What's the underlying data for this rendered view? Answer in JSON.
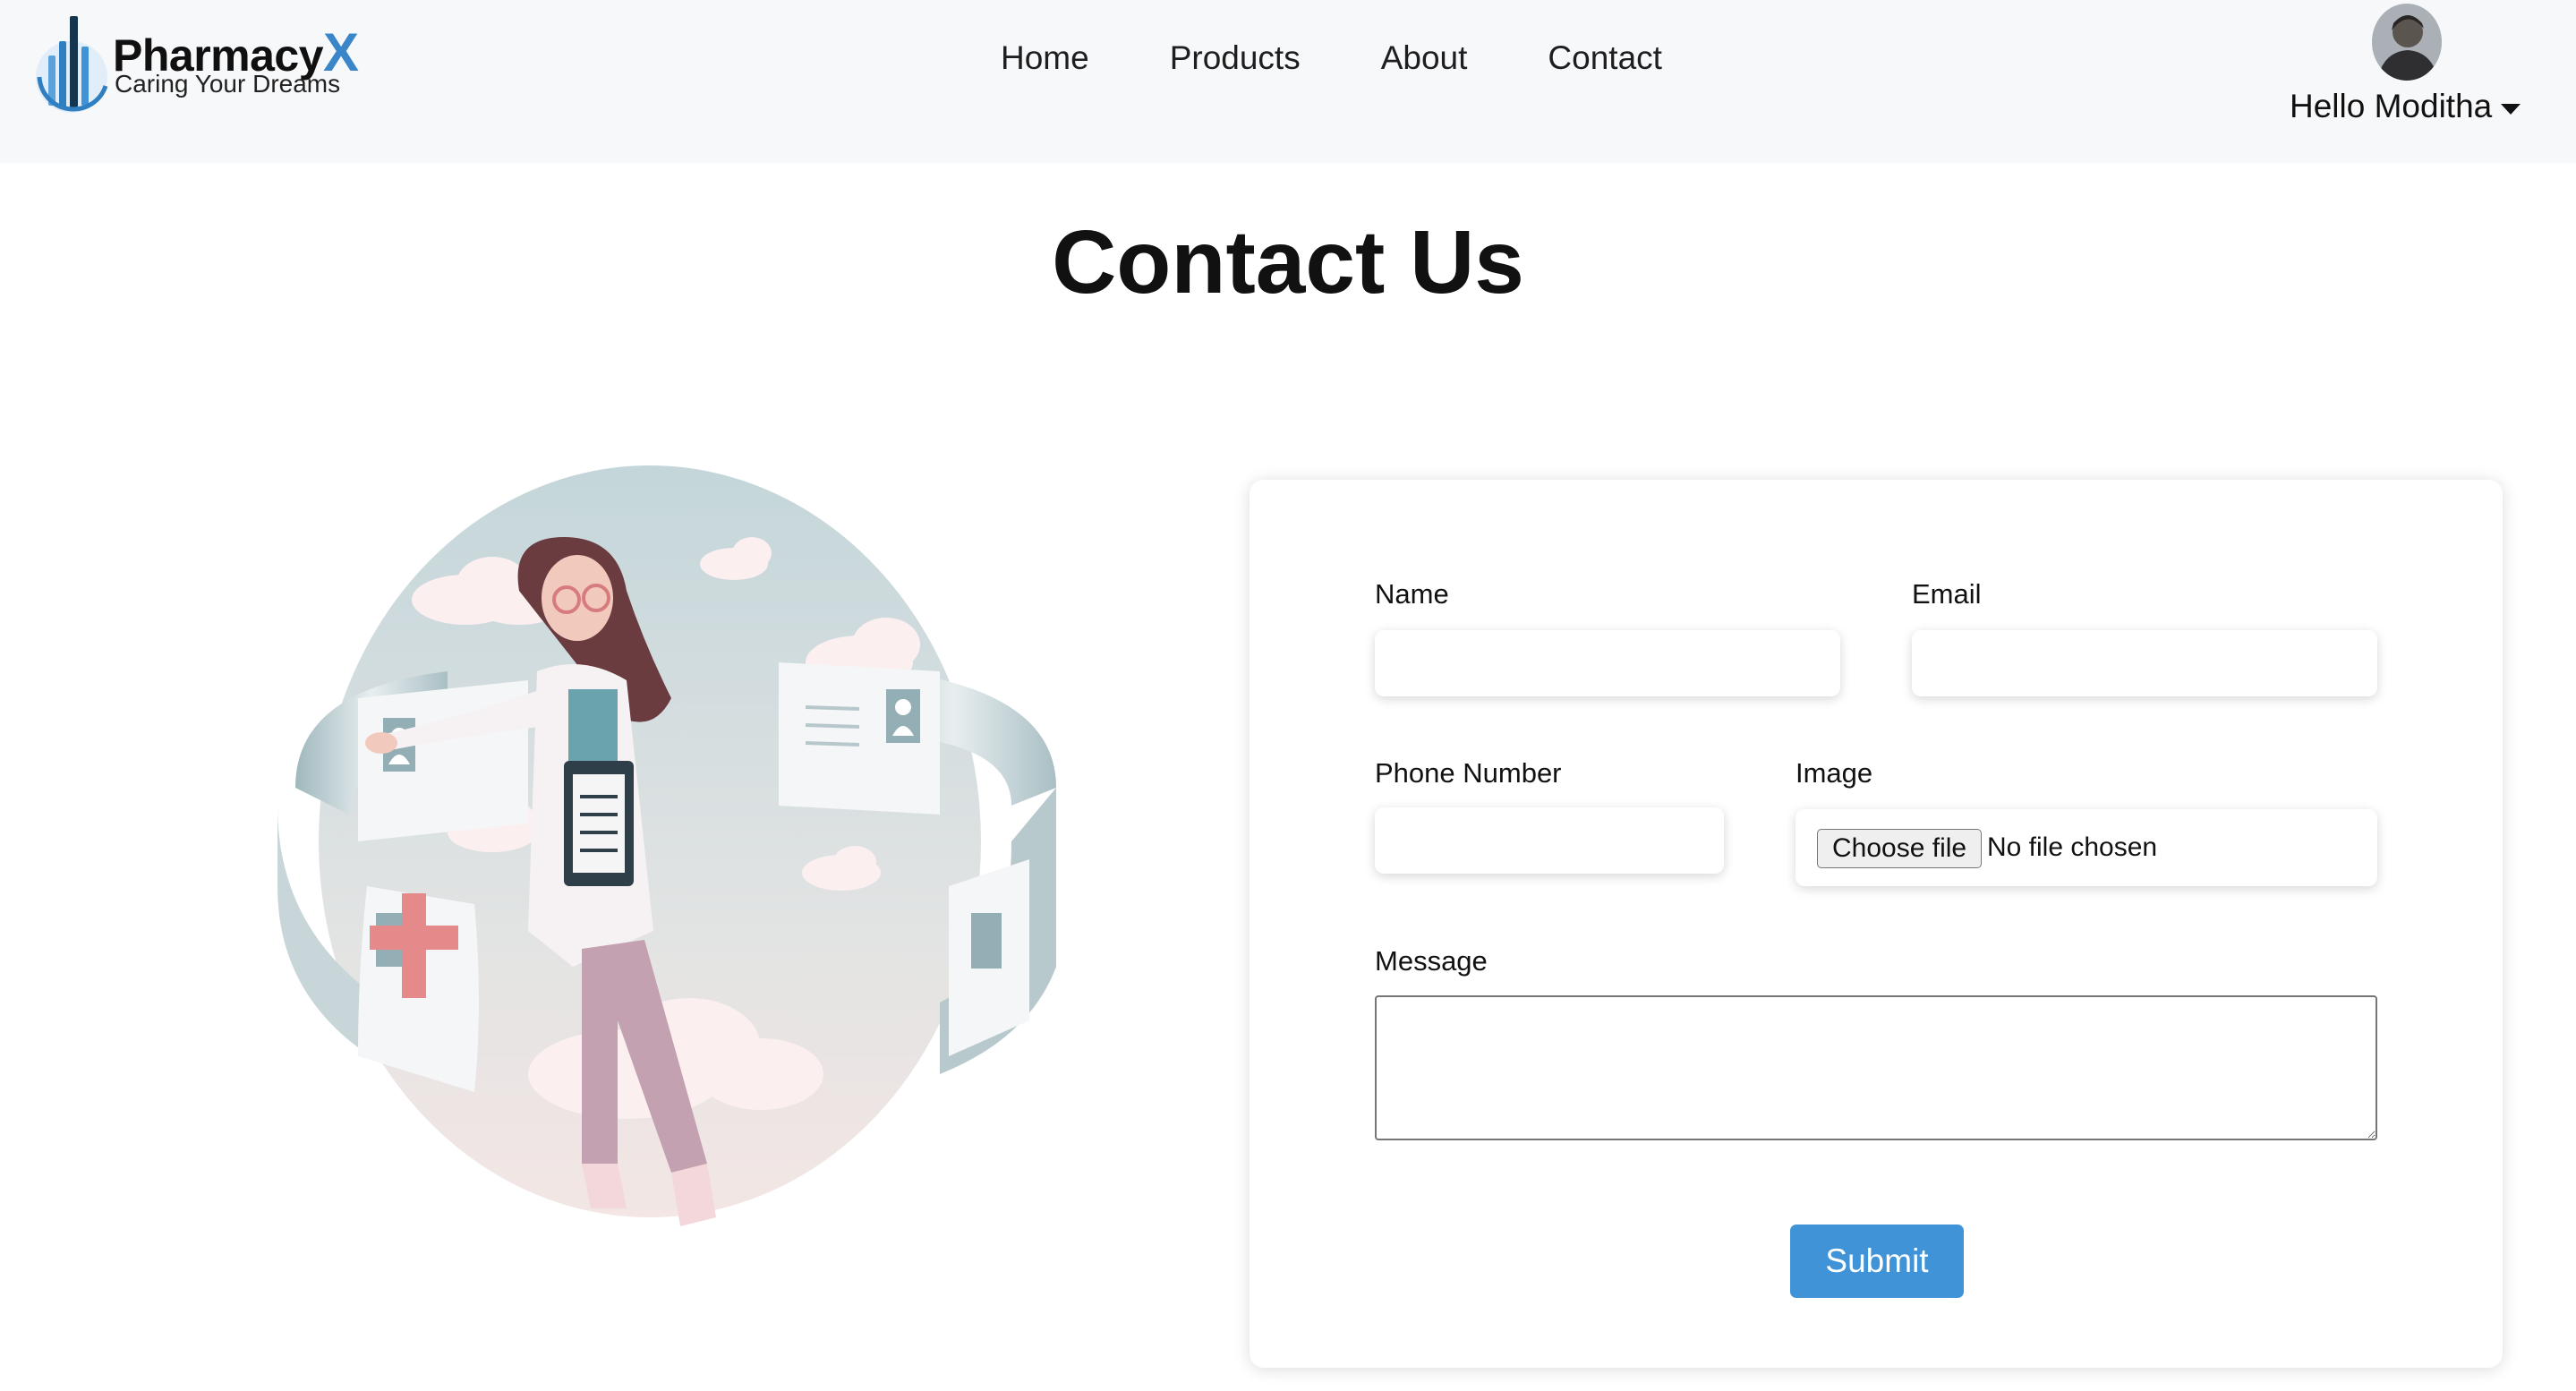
{
  "brand": {
    "name": "Pharmacy",
    "name_accent": "X",
    "tagline": "Caring Your Dreams"
  },
  "nav": {
    "items": [
      "Home",
      "Products",
      "About",
      "Contact"
    ]
  },
  "user": {
    "greeting": "Hello Moditha"
  },
  "page": {
    "title": "Contact Us"
  },
  "form": {
    "name_label": "Name",
    "email_label": "Email",
    "phone_label": "Phone Number",
    "image_label": "Image",
    "file_button": "Choose file",
    "file_status": "No file chosen",
    "message_label": "Message",
    "submit_label": "Submit",
    "name_value": "",
    "email_value": "",
    "phone_value": "",
    "message_value": ""
  },
  "colors": {
    "accent": "#3f93d6",
    "brand_x": "#3b86c8",
    "header_bg": "#f7f8fa"
  },
  "icons": {
    "logo": "pharmacy-logo-icon",
    "dropdown": "caret-down-icon"
  }
}
